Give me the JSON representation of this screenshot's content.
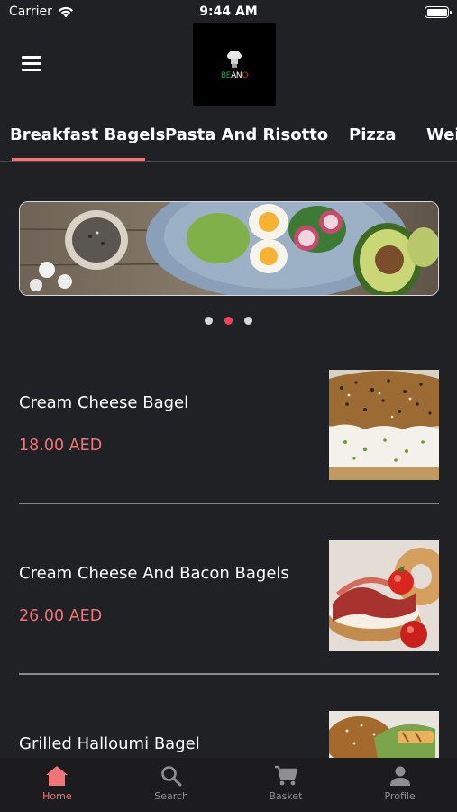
{
  "status_bar": {
    "carrier": "Carrier",
    "time": "9:44 AM"
  },
  "header": {
    "logo_text": {
      "part1": "BE",
      "part2": "AN",
      "part3": "O"
    }
  },
  "tabs": [
    {
      "label": "Breakfast Bagels",
      "active": true
    },
    {
      "label": "Pasta And Risotto",
      "active": false
    },
    {
      "label": "Pizza",
      "active": false
    },
    {
      "label": "Wei",
      "active": false
    }
  ],
  "carousel": {
    "page_count": 3,
    "active_index": 1
  },
  "menu_items": [
    {
      "name": "Cream Cheese Bagel",
      "price": "18.00 AED"
    },
    {
      "name": "Cream Cheese And Bacon Bagels",
      "price": "26.00 AED"
    },
    {
      "name": "Grilled Halloumi Bagel",
      "price": ""
    }
  ],
  "bottom_nav": [
    {
      "label": "Home",
      "icon": "home-icon",
      "active": true
    },
    {
      "label": "Search",
      "icon": "search-icon",
      "active": false
    },
    {
      "label": "Basket",
      "icon": "cart-icon",
      "active": false
    },
    {
      "label": "Profile",
      "icon": "person-icon",
      "active": false
    }
  ],
  "colors": {
    "accent": "#f07478",
    "background": "#202124",
    "dot_active": "#f0435a"
  }
}
